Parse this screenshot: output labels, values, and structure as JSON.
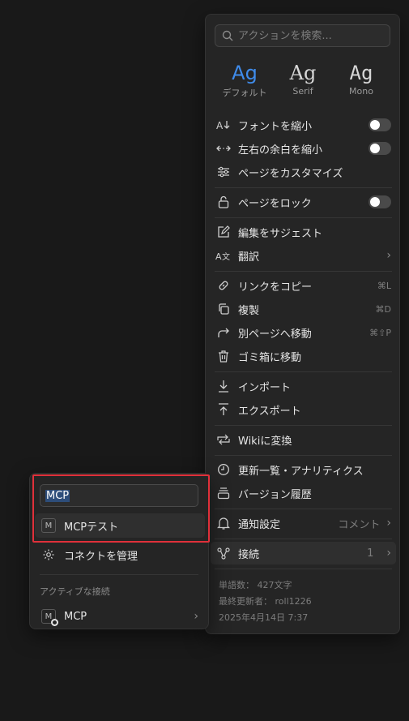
{
  "search": {
    "placeholder": "アクションを検索..."
  },
  "font_options": [
    {
      "glyph": "Ag",
      "label": "デフォルト",
      "active": true
    },
    {
      "glyph": "Ag",
      "label": "Serif"
    },
    {
      "glyph": "Ag",
      "label": "Mono"
    }
  ],
  "menu": {
    "small_text": "フォントを縮小",
    "full_width": "左右の余白を縮小",
    "customize": "ページをカスタマイズ",
    "lock": "ページをロック",
    "suggest": "編集をサジェスト",
    "translate": "翻訳",
    "copy_link": "リンクをコピー",
    "copy_link_sc": "⌘L",
    "duplicate": "複製",
    "duplicate_sc": "⌘D",
    "move": "別ページへ移動",
    "move_sc": "⌘⇧P",
    "trash": "ゴミ箱に移動",
    "import": "インポート",
    "export": "エクスポート",
    "wiki": "Wikiに変換",
    "updates": "更新一覧・アナリティクス",
    "history": "バージョン履歴",
    "notify": "通知設定",
    "notify_val": "コメント",
    "connections": "接続",
    "connections_count": "1"
  },
  "footer": {
    "words": "単語数： 427文字",
    "editor": "最終更新者： roll1226",
    "date": "2025年4月14日 7:37"
  },
  "panel": {
    "input_value": "MCP",
    "result_badge": "M",
    "result_label": "MCPテスト",
    "manage": "コネクトを管理",
    "active_header": "アクティブな接続",
    "active_badge": "M",
    "active_label": "MCP"
  },
  "colors": {
    "accent": "#3f8bea",
    "highlight_border": "#e0303a",
    "background": "#191919",
    "menu_bg": "#252525"
  },
  "icons": [
    "search-icon",
    "font-size-icon",
    "arrows-horizontal-icon",
    "sliders-icon",
    "lock-icon",
    "edit-suggest-icon",
    "translate-icon",
    "link-icon",
    "copy-icon",
    "move-arrow-icon",
    "trash-icon",
    "import-icon",
    "export-icon",
    "convert-icon",
    "clock-icon",
    "history-icon",
    "bell-icon",
    "connection-icon",
    "gear-icon",
    "chevron-right-icon"
  ]
}
